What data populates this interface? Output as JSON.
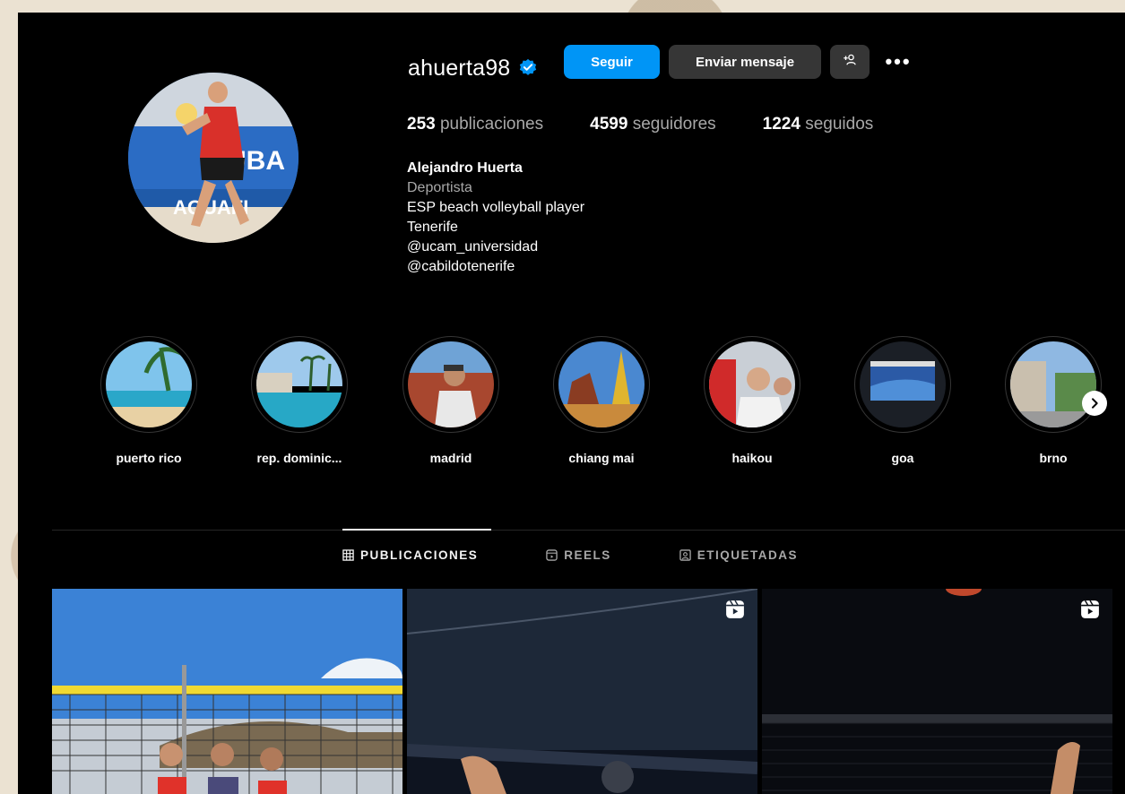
{
  "profile": {
    "username": "ahuerta98",
    "follow_label": "Seguir",
    "message_label": "Enviar mensaje",
    "more_label": "•••",
    "stats": {
      "posts_count": "253",
      "posts_label": "publicaciones",
      "followers_count": "4599",
      "followers_label": "seguidores",
      "following_count": "1224",
      "following_label": "seguidos"
    },
    "bio": {
      "name": "Alejandro Huerta",
      "category": "Deportista",
      "line1": "ESP beach volleyball player",
      "line2": "Tenerife",
      "line3": "@ucam_universidad",
      "line4": "@cabildotenerife"
    }
  },
  "highlights": [
    {
      "label": "puerto rico"
    },
    {
      "label": "rep. dominic..."
    },
    {
      "label": "madrid"
    },
    {
      "label": "chiang mai"
    },
    {
      "label": "haikou"
    },
    {
      "label": "goa"
    },
    {
      "label": "brno"
    }
  ],
  "tabs": [
    {
      "label": "PUBLICACIONES"
    },
    {
      "label": "REELS"
    },
    {
      "label": "ETIQUETADAS"
    }
  ],
  "colors": {
    "primary": "#0095f6",
    "secondary_button": "#363636",
    "background": "#000000",
    "muted_text": "#a8a8a8"
  },
  "icons": {
    "verified": "verified-badge-icon",
    "add_user": "add-user-icon",
    "grid": "grid-icon",
    "reels": "reels-icon",
    "tagged": "tagged-icon",
    "next": "chevron-right-icon"
  }
}
